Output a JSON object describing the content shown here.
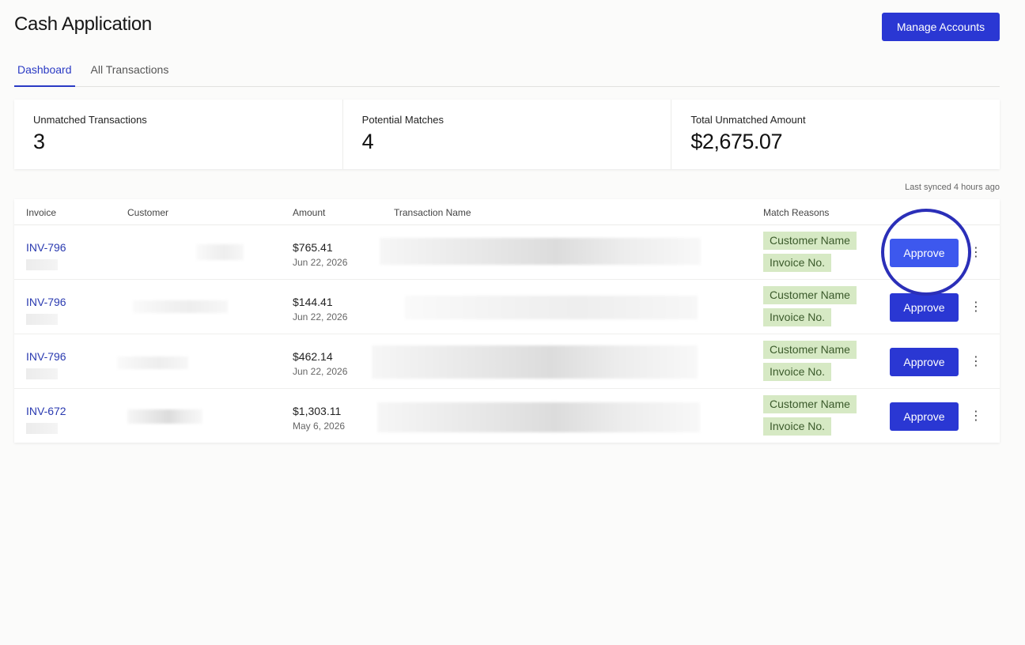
{
  "header": {
    "title": "Cash Application",
    "manage_accounts_label": "Manage Accounts"
  },
  "tabs": [
    {
      "label": "Dashboard",
      "active": true
    },
    {
      "label": "All Transactions",
      "active": false
    }
  ],
  "stats": [
    {
      "label": "Unmatched Transactions",
      "value": "3"
    },
    {
      "label": "Potential Matches",
      "value": "4"
    },
    {
      "label": "Total Unmatched Amount",
      "value": "$2,675.07"
    }
  ],
  "sync_status": "Last synced 4 hours ago",
  "table": {
    "columns": [
      "Invoice",
      "Customer",
      "Amount",
      "Transaction Name",
      "Match Reasons"
    ],
    "rows": [
      {
        "invoice": "INV-796",
        "amount": "$765.41",
        "date": "Jun 22, 2026",
        "reasons": [
          "Customer Name",
          "Invoice No."
        ],
        "action": "Approve"
      },
      {
        "invoice": "INV-796",
        "amount": "$144.41",
        "date": "Jun 22, 2026",
        "reasons": [
          "Customer Name",
          "Invoice No."
        ],
        "action": "Approve"
      },
      {
        "invoice": "INV-796",
        "amount": "$462.14",
        "date": "Jun 22, 2026",
        "reasons": [
          "Customer Name",
          "Invoice No."
        ],
        "action": "Approve"
      },
      {
        "invoice": "INV-672",
        "amount": "$1,303.11",
        "date": "May 6, 2026",
        "reasons": [
          "Customer Name",
          "Invoice No."
        ],
        "action": "Approve"
      }
    ]
  },
  "colors": {
    "accent": "#2a37d3",
    "link": "#2a3ab0",
    "tag_bg": "#d6e9c4",
    "tag_text": "#3b5a2b",
    "highlight_ring": "#2b2fb8"
  },
  "icons": {
    "row_menu": "kebab-menu-icon"
  }
}
